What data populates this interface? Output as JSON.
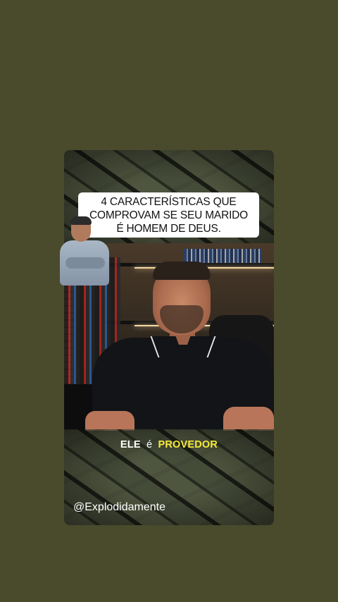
{
  "overlay": {
    "title": "4 CARACTERÍSTICAS QUE\nCOMPROVAM SE SEU MARIDO\nÉ HOMEM DE DEUS."
  },
  "caption": {
    "word1": "ELE",
    "word2": "é",
    "word3": "PROVEDOR"
  },
  "watermark": {
    "handle": "@Explodidamente"
  },
  "colors": {
    "page_background": "#4a4a2c",
    "caption_highlight": "#f5ea3b",
    "title_box": "#ffffff"
  }
}
